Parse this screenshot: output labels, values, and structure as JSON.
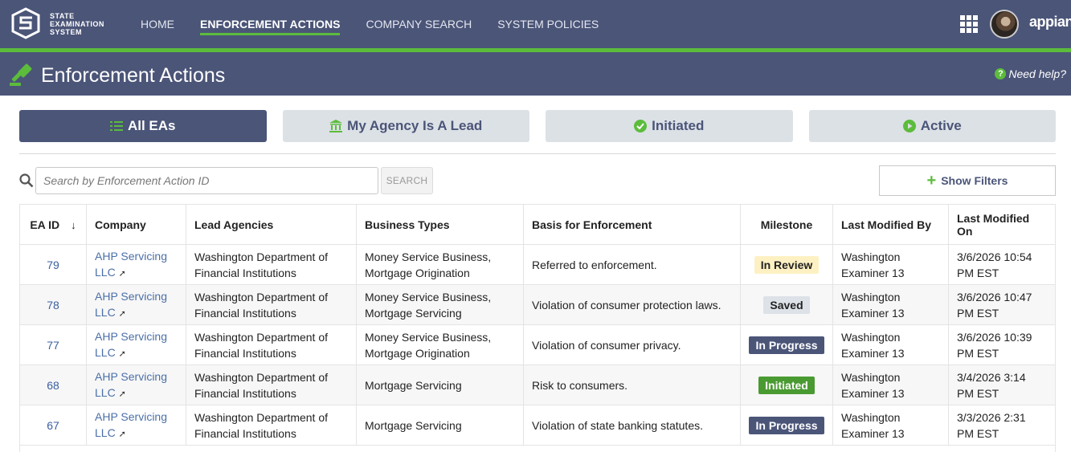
{
  "brand": {
    "logo_text": "STATE EXAMINATION SYSTEM",
    "appian_label": "appian"
  },
  "nav": {
    "items": [
      {
        "label": "HOME",
        "active": false
      },
      {
        "label": "ENFORCEMENT ACTIONS",
        "active": true
      },
      {
        "label": "COMPANY SEARCH",
        "active": false
      },
      {
        "label": "SYSTEM POLICIES",
        "active": false
      }
    ]
  },
  "header": {
    "title": "Enforcement Actions",
    "help": "Need help?"
  },
  "tabs": [
    {
      "label": "All EAs",
      "icon": "list-icon",
      "active": true
    },
    {
      "label": "My Agency Is A Lead",
      "icon": "bank-icon",
      "active": false
    },
    {
      "label": "Initiated",
      "icon": "check-circle-icon",
      "active": false
    },
    {
      "label": "Active",
      "icon": "play-circle-icon",
      "active": false
    }
  ],
  "search": {
    "placeholder": "Search by Enforcement Action ID",
    "value": "",
    "button": "SEARCH"
  },
  "filters": {
    "label": "Show Filters"
  },
  "table": {
    "headers": [
      "EA ID",
      "Company",
      "Lead Agencies",
      "Business Types",
      "Basis for Enforcement",
      "Milestone",
      "Last Modified By",
      "Last Modified On"
    ],
    "rows": [
      {
        "id": "79",
        "company_line1": "AHP Servicing",
        "company_line2": "LLC",
        "lead_line1": "Washington Department of",
        "lead_line2": "Financial Institutions",
        "bt_line1": "Money Service Business,",
        "bt_line2": "Mortgage Origination",
        "basis": "Referred to enforcement.",
        "milestone": "In Review",
        "mod_by_line1": "Washington",
        "mod_by_line2": "Examiner 13",
        "mod_on_line1": "3/6/2026 10:54",
        "mod_on_line2": "PM EST"
      },
      {
        "id": "78",
        "company_line1": "AHP Servicing",
        "company_line2": "LLC",
        "lead_line1": "Washington Department of",
        "lead_line2": "Financial Institutions",
        "bt_line1": "Money Service Business,",
        "bt_line2": "Mortgage Servicing",
        "basis": "Violation of consumer protection laws.",
        "milestone": "Saved",
        "mod_by_line1": "Washington",
        "mod_by_line2": "Examiner 13",
        "mod_on_line1": "3/6/2026 10:47",
        "mod_on_line2": "PM EST"
      },
      {
        "id": "77",
        "company_line1": "AHP Servicing",
        "company_line2": "LLC",
        "lead_line1": "Washington Department of",
        "lead_line2": "Financial Institutions",
        "bt_line1": "Money Service Business,",
        "bt_line2": "Mortgage Origination",
        "basis": "Violation of consumer privacy.",
        "milestone": "In Progress",
        "mod_by_line1": "Washington",
        "mod_by_line2": "Examiner 13",
        "mod_on_line1": "3/6/2026 10:39",
        "mod_on_line2": "PM EST"
      },
      {
        "id": "68",
        "company_line1": "AHP Servicing",
        "company_line2": "LLC",
        "lead_line1": "Washington Department of",
        "lead_line2": "Financial Institutions",
        "bt_line1": "Mortgage Servicing",
        "bt_line2": "",
        "basis": "Risk to consumers.",
        "milestone": "Initiated",
        "mod_by_line1": "Washington",
        "mod_by_line2": "Examiner 13",
        "mod_on_line1": "3/4/2026 3:14",
        "mod_on_line2": "PM EST"
      },
      {
        "id": "67",
        "company_line1": "AHP Servicing",
        "company_line2": "LLC",
        "lead_line1": "Washington Department of",
        "lead_line2": "Financial Institutions",
        "bt_line1": "Mortgage Servicing",
        "bt_line2": "",
        "basis": "Violation of state banking statutes.",
        "milestone": "In Progress",
        "mod_by_line1": "Washington",
        "mod_by_line2": "Examiner 13",
        "mod_on_line1": "3/3/2026 2:31",
        "mod_on_line2": "PM EST"
      }
    ]
  },
  "milestone_colors": {
    "In Review": {
      "bg": "#fdf1c3",
      "fg": "#222222"
    },
    "Saved": {
      "bg": "#dde2e8",
      "fg": "#222222"
    },
    "In Progress": {
      "bg": "#4b5578",
      "fg": "#ffffff"
    },
    "Initiated": {
      "bg": "#4a9a32",
      "fg": "#ffffff"
    }
  },
  "colors": {
    "primary": "#4b5578",
    "accent": "#5cbc3c",
    "tab_inactive": "#dce1e6"
  }
}
